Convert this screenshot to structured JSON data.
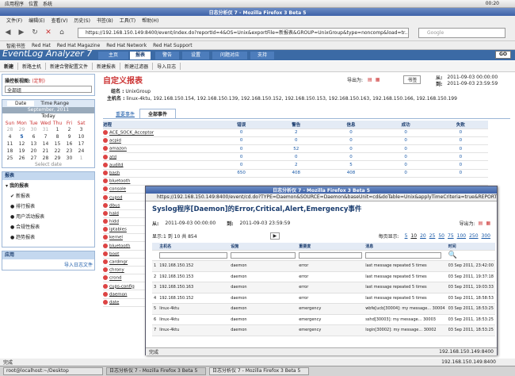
{
  "topbar": {
    "apps": "应用程序",
    "places": "位置",
    "system": "系统",
    "time": "00:20"
  },
  "window": {
    "title": "日志分析仪 7 - Mozilla Firefox 3 Beta 5"
  },
  "menu": [
    "文件(F)",
    "编辑(E)",
    "查看(V)",
    "历史(S)",
    "书签(B)",
    "工具(T)",
    "帮助(H)"
  ],
  "url": "https://192.168.150.149:8400/event/index.do?reportId=4&OS=Unix&exportFile=新报表&GROUP=UnixGroup&type=noncomp&load=tr...",
  "search_placeholder": "Google",
  "bookmarks": [
    "智能书签",
    "Red Hat",
    "Red Hat Magazine",
    "Red Hat Network",
    "Red Hat Support"
  ],
  "app": {
    "title": "EventLog Analyzer 7",
    "tabs": [
      "主页",
      "报表",
      "警告",
      "设置",
      "问题对应",
      "支持"
    ],
    "go": "GO"
  },
  "subnav": [
    "新建",
    "新路主机",
    "新建合警配置文件",
    "新建报表",
    "新建过滤器",
    "导入日志"
  ],
  "sidebar": {
    "filter_label": "操控板视图:",
    "filter_link": "(定制)",
    "filter_value": "全部组",
    "cal_tabs": [
      "Date",
      "Time Range"
    ],
    "cal_month": "September, 2011",
    "cal_today": "Today",
    "cal_days": [
      "Sun",
      "Mon",
      "Tue",
      "Wed",
      "Thu",
      "Fri",
      "Sat"
    ],
    "cal_rows": [
      [
        "28",
        "29",
        "30",
        "31",
        "1",
        "2",
        "3"
      ],
      [
        "4",
        "5",
        "6",
        "7",
        "8",
        "9",
        "10"
      ],
      [
        "11",
        "12",
        "13",
        "14",
        "15",
        "16",
        "17"
      ],
      [
        "18",
        "19",
        "20",
        "21",
        "22",
        "23",
        "24"
      ],
      [
        "25",
        "26",
        "27",
        "28",
        "29",
        "30",
        "1"
      ]
    ],
    "cal_footer": "Select date",
    "reports_header": "报表",
    "reports": [
      "我的报表",
      "新报表",
      "排行报表",
      "用户活动报表",
      "合规性报表",
      "趋势报表"
    ],
    "apps_header": "应用",
    "import_link": "导入日志文件"
  },
  "main": {
    "title": "自定义报表",
    "export_label": "导出为:",
    "bookmark": "书签",
    "group_label": "组名 :",
    "group_value": "UnixGroup",
    "hosts_label": "主机名 :",
    "hosts_value": "linux-4ktu, 192.168.150.154, 192.168.150.139, 192.168.150.152, 192.168.150.153, 192.168.150.163, 192.168.150.166, 192.168.150.199",
    "from_label": "从:",
    "from_value": "2011-09-03 00:00:00",
    "to_label": "到:",
    "to_value": "2011-09-03 23:59:59",
    "tabs": [
      "重要事件",
      "全部事件"
    ],
    "columns": [
      "进程",
      "错误",
      "警告",
      "信息",
      "成功",
      "失败"
    ],
    "rows": [
      [
        "ACE_SOCK_Acceptor",
        "0",
        "2",
        "0",
        "0",
        "0"
      ],
      [
        "acpid",
        "0",
        "0",
        "0",
        "0",
        "0"
      ],
      [
        "amazon",
        "0",
        "52",
        "0",
        "0",
        "0"
      ],
      [
        "atd",
        "0",
        "0",
        "0",
        "0",
        "0"
      ],
      [
        "auditd",
        "0",
        "2",
        "5",
        "0",
        "0"
      ],
      [
        "bash",
        "650",
        "408",
        "408",
        "0",
        "0"
      ],
      [
        "bluetooth",
        "",
        "",
        "",
        "",
        ""
      ],
      [
        "console",
        "",
        "",
        "",
        "",
        ""
      ],
      [
        "cupsd",
        "",
        "",
        "",
        "",
        ""
      ],
      [
        "dbus",
        "",
        "",
        "",
        "",
        ""
      ],
      [
        "hald",
        "",
        "",
        "",
        "",
        ""
      ],
      [
        "hidd",
        "",
        "",
        "",
        "",
        ""
      ],
      [
        "iptables",
        "",
        "",
        "",
        "",
        ""
      ],
      [
        "kernel",
        "",
        "",
        "",
        "",
        ""
      ],
      [
        "bluetooth",
        "",
        "",
        "",
        "",
        ""
      ],
      [
        "boot",
        "",
        "",
        "",
        "",
        ""
      ],
      [
        "cardmgr",
        "",
        "",
        "",
        "",
        ""
      ],
      [
        "chrony",
        "",
        "",
        "",
        "",
        ""
      ],
      [
        "crond",
        "",
        "",
        "",
        "",
        ""
      ],
      [
        "cups-config",
        "",
        "",
        "",
        "",
        ""
      ],
      [
        "daemon",
        "",
        "",
        "",
        "",
        ""
      ],
      [
        "date",
        "",
        "",
        "",
        "",
        ""
      ]
    ]
  },
  "popup": {
    "title": "日志分析仪 7 - Mozilla Firefox 3 Beta 5",
    "url": "https://192.168.150.149:8400/event/cd.do?TYPE=Daemon&SOURCE=Daemon&baseUnit=cd&doTable=Unix&applyTimeCriteria=true&REPORTID=4",
    "heading": "Syslog程序[Daemon]的Error,Critical,Alert,Emergency事件",
    "export_label": "导出为:",
    "from_label": "从:",
    "from_value": "2011-09-03 00:00:00",
    "to_label": "到:",
    "to_value": "2011-09-03 23:59:59",
    "paging": "显示:1 到 10 共 854",
    "per_page_label": "每页显示:",
    "per_page": [
      "5",
      "10",
      "20",
      "25",
      "50",
      "75",
      "100",
      "250",
      "300"
    ],
    "columns": [
      "主机名",
      "设施",
      "重要度",
      "消息",
      "时间"
    ],
    "rows": [
      [
        "1",
        "192.168.150.152",
        "daemon",
        "error",
        "last message repeated 5 times",
        "03 Sep 2011, 23:42:00"
      ],
      [
        "2",
        "192.168.150.153",
        "daemon",
        "error",
        "last message repeated 5 times",
        "03 Sep 2011, 19:37:18"
      ],
      [
        "3",
        "192.168.150.163",
        "daemon",
        "error",
        "last message repeated 5 times",
        "03 Sep 2011, 19:03:33"
      ],
      [
        "4",
        "192.168.150.152",
        "daemon",
        "error",
        "last message repeated 5 times",
        "03 Sep 2011, 18:58:53"
      ],
      [
        "5",
        "linux-4ktu",
        "daemon",
        "emergency",
        "wbfe[ucb[30004]: my message... 30004",
        "03 Sep 2011, 18:53:25"
      ],
      [
        "6",
        "linux-4ktu",
        "daemon",
        "emergency",
        "sshd[30003]: my message... 30003",
        "03 Sep 2011, 18:53:25"
      ],
      [
        "7",
        "linux-4ktu",
        "daemon",
        "emergency",
        "login[30002]: my message... 30002",
        "03 Sep 2011, 18:53:25"
      ]
    ],
    "status_left": "完成",
    "status_right": "192.168.150.149:8400"
  },
  "status": {
    "left": "完成",
    "right": "192.168.150.149:8400"
  },
  "taskbar": [
    "root@localhost:~/Desktop",
    "日志分析仪 7 - Mozilla Firefox 3 Beta 5",
    "日志分析仪 7 - Mozilla Firefox 3 Beta 5"
  ]
}
